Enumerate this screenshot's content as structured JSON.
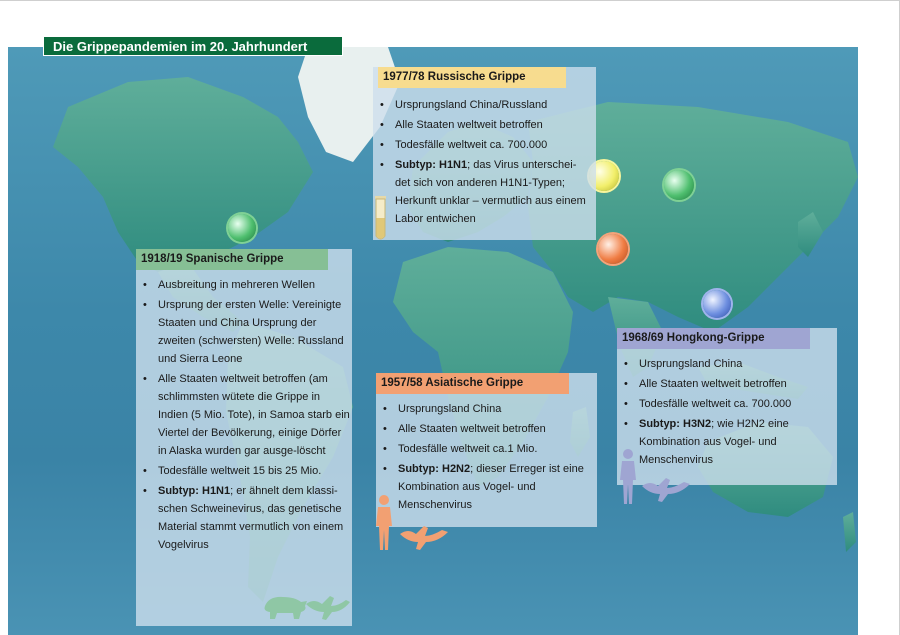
{
  "title": "Die Grippepandemien im 20. Jahrhundert",
  "colors": {
    "title_bg": "#0a6b3c",
    "ocean": "#3d88aa",
    "land": "#3f9a8c",
    "panel_bg": "#cddfec",
    "header_1918": "#86bf95",
    "header_1957": "#f2a072",
    "header_1968": "#9fa5d2",
    "header_1977": "#f7dc8f"
  },
  "panels": {
    "p1918": {
      "header": "1918/19 Spanische Grippe",
      "items": [
        {
          "bold": "",
          "text": "Ausbreitung in mehreren Wellen"
        },
        {
          "bold": "",
          "text": "Ursprung der ersten Welle: Vereinigte Staaten und China Ursprung der zweiten (schwersten) Welle: Russland und Sierra Leone"
        },
        {
          "bold": "",
          "text": "Alle Staaten weltweit betroffen (am schlimmsten wütete die Grippe in Indien (5 Mio. Tote), in Samoa starb ein Viertel der Bevölkerung, einige Dörfer in Alaska wurden gar ausge-löscht"
        },
        {
          "bold": "",
          "text": "Todesfälle weltweit 15 bis 25 Mio."
        },
        {
          "bold": "Subtyp: H1N1",
          "text": "; er ähnelt dem klassi-schen Schweinevirus, das genetische Material stammt vermutlich von einem Vogelvirus"
        }
      ],
      "icons": [
        "pig-icon",
        "bird-icon"
      ]
    },
    "p1957": {
      "header": "1957/58 Asiatische Grippe",
      "items": [
        {
          "bold": "",
          "text": "Ursprungsland China"
        },
        {
          "bold": "",
          "text": "Alle Staaten weltweit betroffen"
        },
        {
          "bold": "",
          "text": "Todesfälle weltweit ca.1 Mio."
        },
        {
          "bold": "Subtyp: H2N2",
          "text": "; dieser Erreger ist eine Kombination aus Vogel- und Menschenvirus"
        }
      ],
      "icons": [
        "human-icon",
        "bird-icon"
      ]
    },
    "p1968": {
      "header": "1968/69 Hongkong-Grippe",
      "items": [
        {
          "bold": "",
          "text": "Ursprungsland China"
        },
        {
          "bold": "",
          "text": "Alle Staaten weltweit betroffen"
        },
        {
          "bold": "",
          "text": "Todesfälle weltweit ca. 700.000"
        },
        {
          "bold": "Subtyp: H3N2",
          "text": "; wie H2N2 eine Kombination aus Vogel- und Menschenvirus"
        }
      ],
      "icons": [
        "human-icon",
        "bird-icon"
      ]
    },
    "p1977": {
      "header": "1977/78 Russische Grippe",
      "items": [
        {
          "bold": "",
          "text": "Ursprungsland China/Russland"
        },
        {
          "bold": "",
          "text": "Alle Staaten weltweit betroffen"
        },
        {
          "bold": "",
          "text": "Todesfälle weltweit ca. 700.000"
        },
        {
          "bold": "Subtyp: H1N1",
          "text": "; das Virus unterschei-det sich von anderen H1N1-Typen; Herkunft unklar – vermutlich aus einem Labor entwichen"
        }
      ],
      "icons": [
        "test-tube-icon"
      ]
    }
  }
}
